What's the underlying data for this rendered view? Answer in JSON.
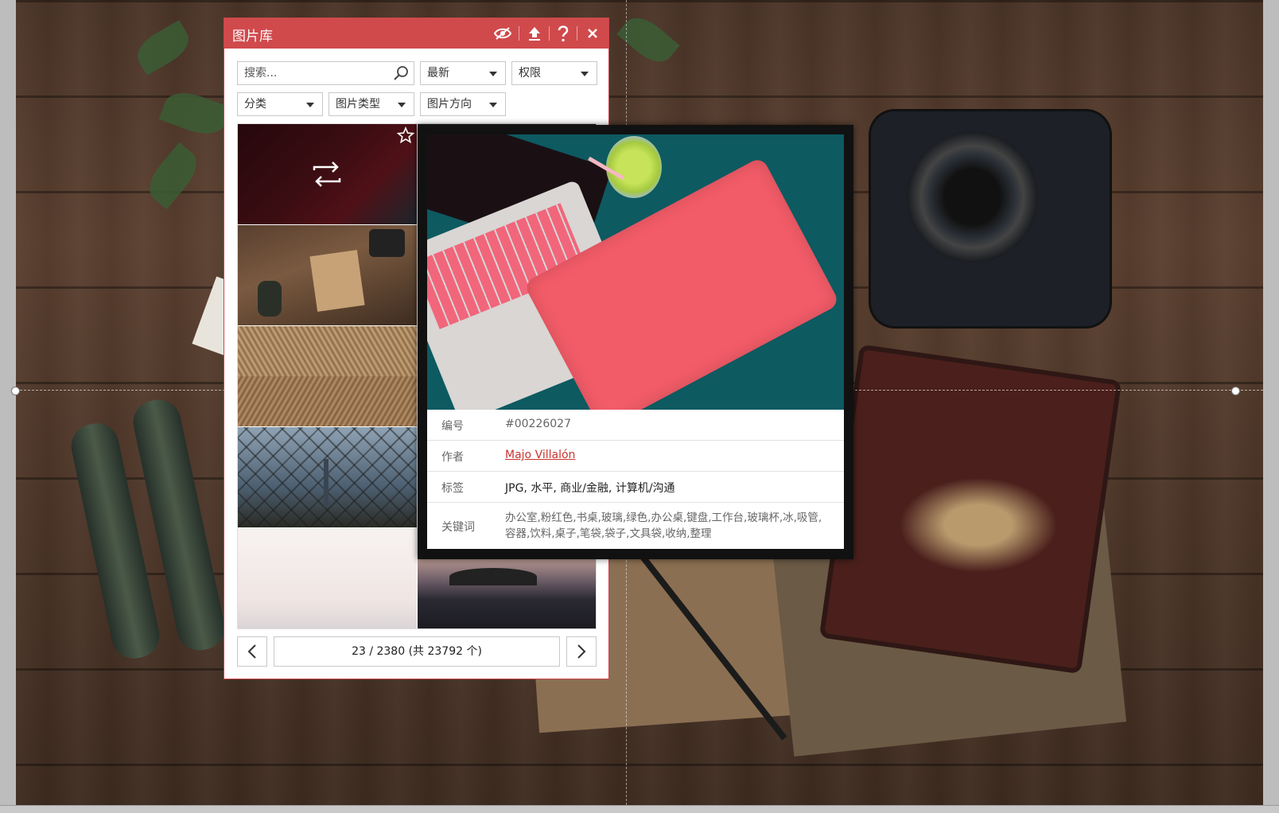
{
  "panel": {
    "title": "图片库",
    "icons": [
      "hide-icon",
      "upload-icon",
      "help-icon",
      "close-icon"
    ]
  },
  "filters": {
    "search_placeholder": "搜索...",
    "sort": "最新",
    "license": "权限",
    "category": "分类",
    "image_type": "图片类型",
    "orientation": "图片方向"
  },
  "pagination": {
    "label": "23 / 2380 (共 23792 个)"
  },
  "preview": {
    "id_label": "编号",
    "id_value": "#00226027",
    "author_label": "作者",
    "author_value": "Majo Villalón",
    "tags_label": "标签",
    "tags_value": "JPG, 水平, 商业/金融, 计算机/沟通",
    "keywords_label": "关键词",
    "keywords_value": "办公室,粉红色,书桌,玻璃,绿色,办公桌,键盘,工作台,玻璃杯,冰,吸管,容器,饮料,桌子,笔袋,袋子,文具袋,收纳,整理"
  },
  "colors": {
    "accent": "#d04a4c",
    "link": "#c9342f"
  }
}
